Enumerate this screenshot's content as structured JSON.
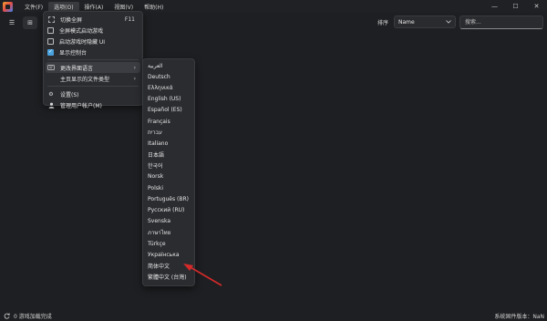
{
  "menubar": {
    "items": [
      "文件(F)",
      "选项(O)",
      "操作(A)",
      "视图(V)",
      "帮助(H)"
    ],
    "active_index": 1
  },
  "window_controls": {
    "minimize": "—",
    "maximize": "☐",
    "close": "✕"
  },
  "toolbar": {
    "list_icon": "☰",
    "grid_icon": "⊞",
    "sort_label": "排序",
    "sort_value": "Name",
    "search_placeholder": "搜索..."
  },
  "options_menu": {
    "toggle_fullscreen": "切换全屏",
    "toggle_fullscreen_shortcut": "F11",
    "fullscreen_startup": "全屏模式启动游戏",
    "hide_ui_on_startup": "启动游戏时隐藏 UI",
    "show_console": "显示控制台",
    "change_language": "更改界面语言",
    "main_file_types": "主页显示的文件类型",
    "settings": "设置(S)",
    "manage_accounts": "管理用户帐户(M)"
  },
  "languages": [
    "العربية",
    "Deutsch",
    "Ελληνικά",
    "English (US)",
    "Español (ES)",
    "Français",
    "עברית",
    "Italiano",
    "日本語",
    "한국어",
    "Norsk",
    "Polski",
    "Português (BR)",
    "Русский (RU)",
    "Svenska",
    "ภาษาไทย",
    "Türkçe",
    "Українська",
    "简体中文",
    "繁體中文 (台灣)"
  ],
  "status": {
    "loading_text": "0 游戏加载完成",
    "version_text": "系统固件版本：NaN"
  },
  "colors": {
    "accent": "#4aa3df",
    "arrow": "#d42a2a"
  }
}
